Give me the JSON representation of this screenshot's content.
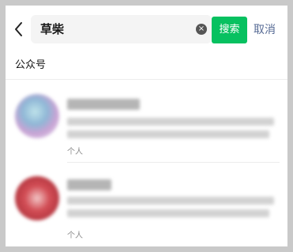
{
  "search": {
    "query": "草柴",
    "button_label": "搜索",
    "cancel_label": "取消"
  },
  "section_title": "公众号",
  "results": [
    {
      "tag": "个人"
    },
    {
      "tag": "个人"
    }
  ],
  "colors": {
    "accent": "#07c160",
    "link": "#576b95",
    "background": "#c9c9c9"
  },
  "icons": {
    "back": "chevron-left-icon",
    "clear": "clear-icon"
  }
}
